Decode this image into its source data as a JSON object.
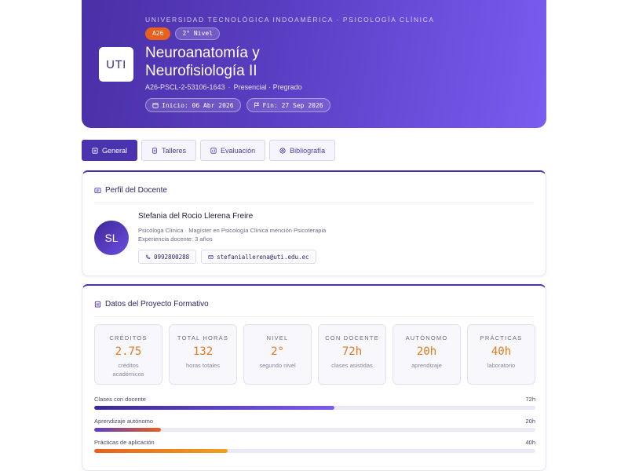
{
  "header": {
    "logo": "UTI",
    "university": "UNIVERSIDAD TECNOLÓGICA INDOAMÉRICA · PSICOLOGÍA CLÍNICA",
    "code_badge": "A26",
    "level_badge": "2° Nivel",
    "title_line1": "Neuroanatomía y",
    "title_line2": "Neurofisiología II",
    "course_code": "A26-PSCL-2-53106-1643",
    "modality": "Presencial · Pregrado",
    "start_date": "Inicio: 06 Abr 2026",
    "end_date": "Fin: 27 Sep 2026",
    "colors": {
      "gradient_start": "#4a2fa6",
      "gradient_end": "#7a5cf0",
      "accent": "#e8601c"
    }
  },
  "tabs": [
    {
      "label": "General",
      "icon": "grid-icon",
      "active": true
    },
    {
      "label": "Talleres",
      "icon": "document-icon",
      "active": false
    },
    {
      "label": "Evaluación",
      "icon": "chart-icon",
      "active": false
    },
    {
      "label": "Bibliografía",
      "icon": "book-icon",
      "active": false
    }
  ],
  "teacher": {
    "section_title": "Perfil del Docente",
    "initials": "SL",
    "name": "Stefania del Rocio Llerena Freire",
    "title": "Psicóloga Clínica · Magíster en Psicología Clínica mención Psicoterapia",
    "experience": "Experiencia docente: 3 años",
    "phone": "0992800288",
    "email": "stefaniallerena@uti.edu.ec"
  },
  "project": {
    "section_title": "Datos del Proyecto Formativo",
    "stats": [
      {
        "label": "CRÉDITOS",
        "value": "2.75",
        "sub": "créditos académicos"
      },
      {
        "label": "TOTAL HORAS",
        "value": "132",
        "sub": "horas totales"
      },
      {
        "label": "NIVEL",
        "value": "2°",
        "sub": "segundo nivel"
      },
      {
        "label": "CON DOCENTE",
        "value": "72h",
        "sub": "clases asistidas"
      },
      {
        "label": "AUTÓNOMO",
        "value": "20h",
        "sub": "aprendizaje"
      },
      {
        "label": "PRÁCTICAS",
        "value": "40h",
        "sub": "laboratorio"
      }
    ],
    "progress": [
      {
        "label": "Clases con docente",
        "value": "72h",
        "fraction": 0.545,
        "color": "#5b3fc4"
      },
      {
        "label": "Aprendizaje autónomo",
        "value": "20h",
        "fraction": 0.152,
        "color": "#e8601c"
      },
      {
        "label": "Prácticas de aplicación",
        "value": "40h",
        "fraction": 0.303,
        "color": "#f0a020"
      }
    ]
  }
}
